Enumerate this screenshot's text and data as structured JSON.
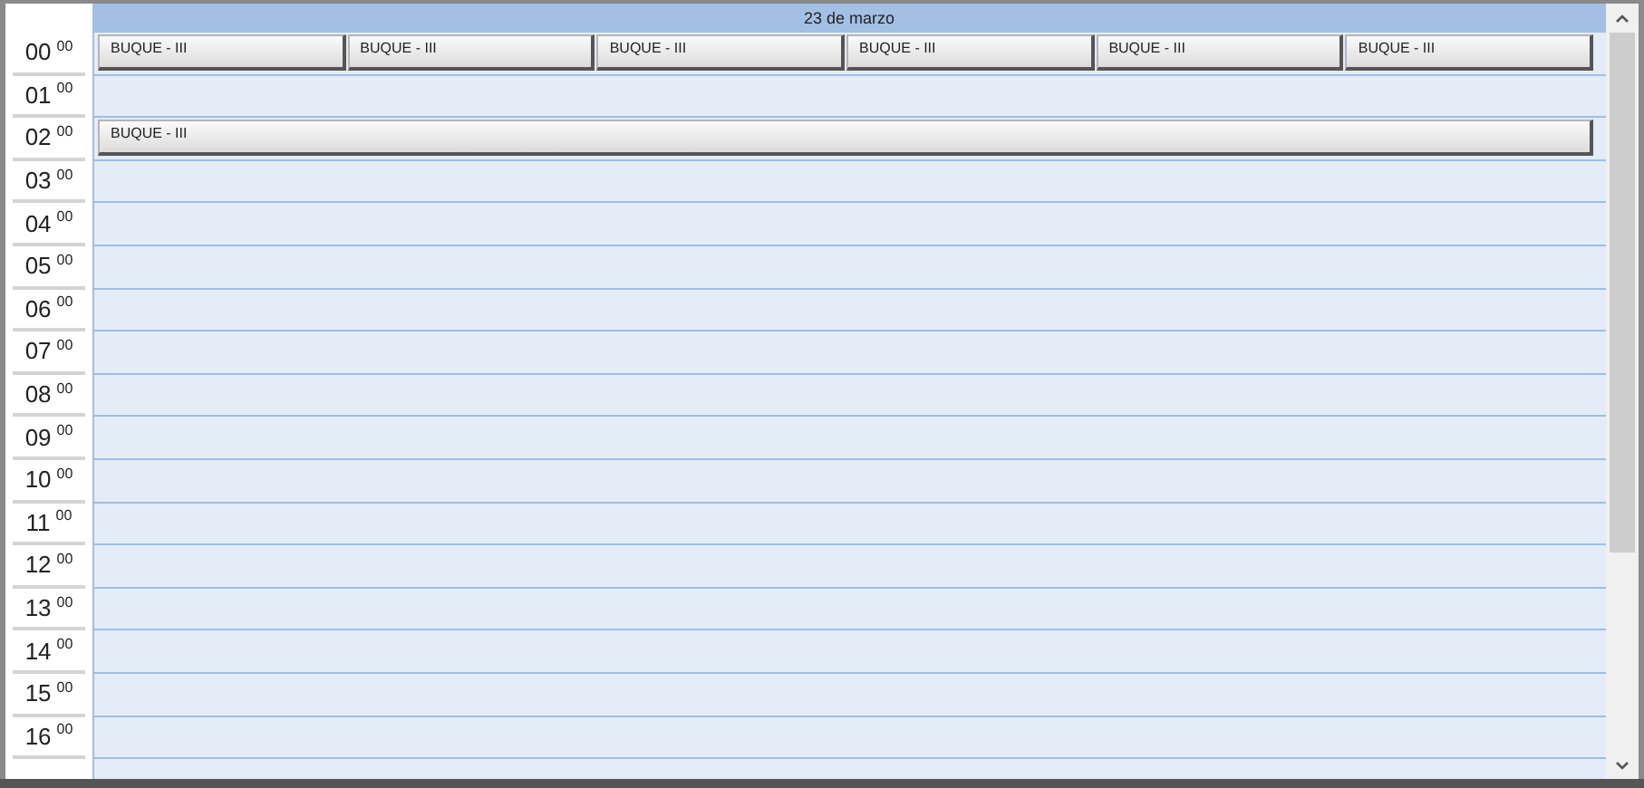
{
  "day_header": "23 de marzo",
  "hours": [
    {
      "hour": "00",
      "minutes": "00",
      "events": [
        "BUQUE - III",
        "BUQUE - III",
        "BUQUE - III",
        "BUQUE - III",
        "BUQUE - III",
        "BUQUE - III"
      ]
    },
    {
      "hour": "01",
      "minutes": "00"
    },
    {
      "hour": "02",
      "minutes": "00",
      "events": [
        "BUQUE - III"
      ]
    },
    {
      "hour": "03",
      "minutes": "00"
    },
    {
      "hour": "04",
      "minutes": "00"
    },
    {
      "hour": "05",
      "minutes": "00"
    },
    {
      "hour": "06",
      "minutes": "00"
    },
    {
      "hour": "07",
      "minutes": "00"
    },
    {
      "hour": "08",
      "minutes": "00"
    },
    {
      "hour": "09",
      "minutes": "00"
    },
    {
      "hour": "10",
      "minutes": "00"
    },
    {
      "hour": "11",
      "minutes": "00"
    },
    {
      "hour": "12",
      "minutes": "00"
    },
    {
      "hour": "13",
      "minutes": "00"
    },
    {
      "hour": "14",
      "minutes": "00"
    },
    {
      "hour": "15",
      "minutes": "00"
    },
    {
      "hour": "16",
      "minutes": "00"
    }
  ]
}
